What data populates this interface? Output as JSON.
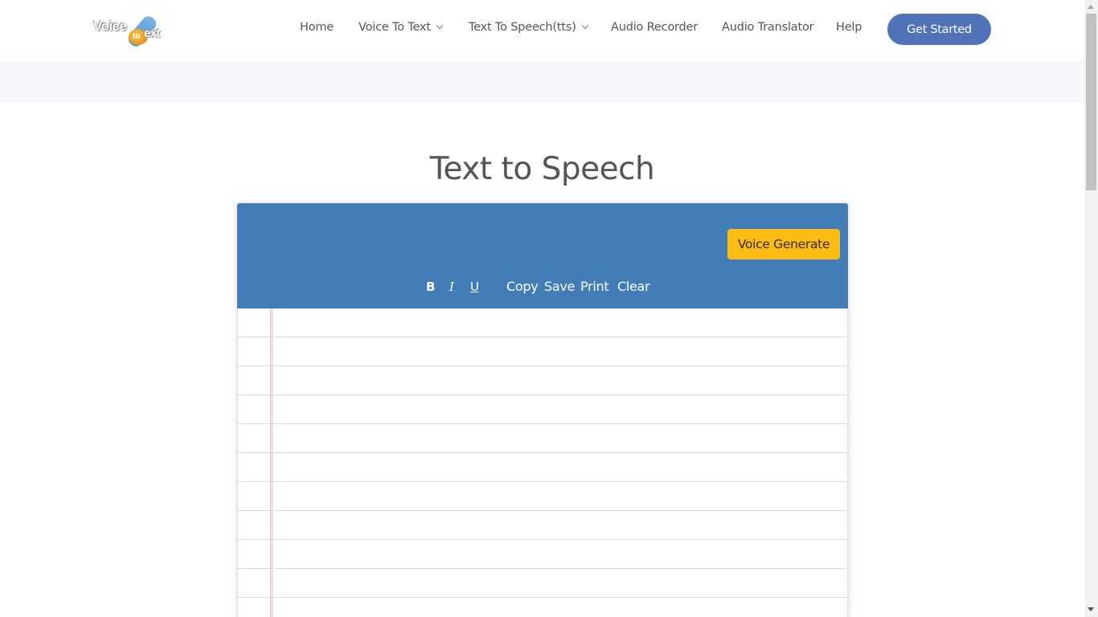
{
  "header": {
    "logo": {
      "word1": "Voice",
      "word2": "to",
      "word3": "ext"
    },
    "nav": [
      {
        "label": "Home",
        "has_dropdown": false
      },
      {
        "label": "Voice To Text",
        "has_dropdown": true
      },
      {
        "label": "Text To Speech(tts)",
        "has_dropdown": true
      },
      {
        "label": "Audio Recorder",
        "has_dropdown": false
      },
      {
        "label": "Audio Translator",
        "has_dropdown": false
      },
      {
        "label": "Help",
        "has_dropdown": false
      }
    ],
    "cta_label": "Get Started"
  },
  "main": {
    "title": "Text to Speech",
    "editor": {
      "generate_label": "Voice Generate",
      "format_tools": {
        "bold": "B",
        "italic": "I",
        "underline": "U"
      },
      "actions": {
        "copy": "Copy",
        "save": "Save",
        "print": "Print",
        "clear": "Clear"
      },
      "text_value": ""
    }
  },
  "colors": {
    "brand_blue": "#427db7",
    "cta_blue": "#4f72b8",
    "generate_yellow": "#fcbc13",
    "text_gray": "#555555"
  }
}
